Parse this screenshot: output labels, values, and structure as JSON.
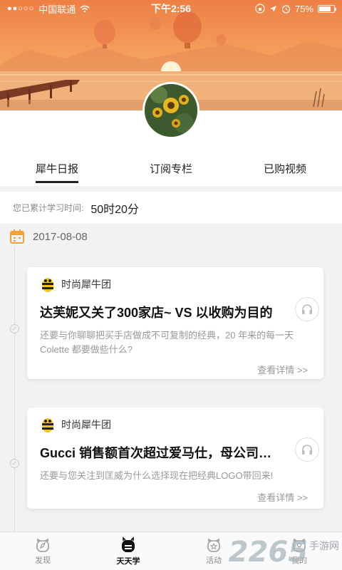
{
  "status_bar": {
    "signal_dots": "●●○○○",
    "carrier": "中国联通",
    "time": "下午2:56",
    "battery": "75%"
  },
  "tabs": [
    {
      "label": "犀牛日报",
      "active": true
    },
    {
      "label": "订阅专栏",
      "active": false
    },
    {
      "label": "已购视频",
      "active": false
    }
  ],
  "study": {
    "label": "您已累计学习时间:",
    "value": "50时20分"
  },
  "timeline": {
    "date": "2017-08-08"
  },
  "articles": [
    {
      "author": "时尚犀牛团",
      "title": "达芙妮又关了300家店~ VS 以收购为目的",
      "desc": "还要与你聊聊把买手店做成不可复制的经典，20 年来的每一天 Colette 都要做些什么?",
      "more": "查看详情 >>"
    },
    {
      "author": "时尚犀牛团",
      "title": "Gucci 销售额首次超过爱马仕，母公司开云",
      "desc": "还要与您关注到匡威为什么选择现在把经典LOGO带回来!",
      "more": "查看详情 >>"
    }
  ],
  "bottom_nav": [
    {
      "label": "发现",
      "icon": "discover-icon",
      "active": false
    },
    {
      "label": "天天学",
      "icon": "study-icon",
      "active": true
    },
    {
      "label": "活动",
      "icon": "activity-icon",
      "active": false
    },
    {
      "label": "我的",
      "icon": "profile-icon",
      "active": false
    }
  ],
  "watermark": {
    "number": "2265",
    "text": "手游网"
  },
  "colors": {
    "banner_orange": "#f08a4a",
    "calendar_orange": "#f0a23a",
    "active_tab": "#222222"
  }
}
